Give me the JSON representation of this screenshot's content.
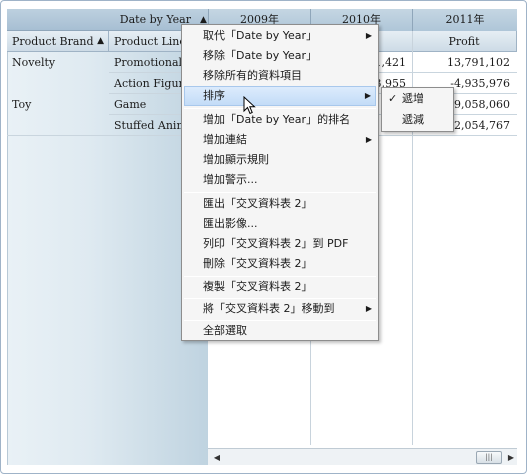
{
  "pivot": {
    "column_field": "Date by Year",
    "years": [
      "2009年",
      "2010年",
      "2011年"
    ],
    "row_headers": [
      "Product Brand",
      "Product Line"
    ],
    "measure": "Profit",
    "rows": [
      {
        "brand": "Novelty",
        "line": "Promotional",
        "v2010": "1,421",
        "v2011": "13,791,102"
      },
      {
        "brand": "",
        "line": "Action Figure",
        "v2010": "3,955",
        "v2011": "-4,935,976"
      },
      {
        "brand": "Toy",
        "line": "Game",
        "v2010": "",
        "v2011": "49,058,060"
      },
      {
        "brand": "",
        "line": "Stuffed Animal",
        "v2010": "",
        "v2011": "2,054,767"
      }
    ]
  },
  "context_menu": {
    "items": [
      {
        "label": "取代「Date by Year」",
        "submenu": true
      },
      {
        "label": "移除「Date by Year」",
        "submenu": false
      },
      {
        "label": "移除所有的資料項目",
        "submenu": false
      },
      {
        "label": "排序",
        "submenu": true
      },
      {
        "label": "增加「Date by Year」的排名",
        "submenu": false
      },
      {
        "label": "增加連結",
        "submenu": true
      },
      {
        "label": "增加顯示規則",
        "submenu": false
      },
      {
        "label": "增加警示...",
        "submenu": false
      },
      {
        "label": "匯出「交叉資料表 2」",
        "submenu": false
      },
      {
        "label": "匯出影像...",
        "submenu": false
      },
      {
        "label": "列印「交叉資料表 2」到 PDF",
        "submenu": false
      },
      {
        "label": "刪除「交叉資料表 2」",
        "submenu": false
      },
      {
        "label": "複製「交叉資料表 2」",
        "submenu": false
      },
      {
        "label": "將「交叉資料表 2」移動到",
        "submenu": true
      },
      {
        "label": "全部選取",
        "submenu": false
      }
    ]
  },
  "sort_submenu": {
    "items": [
      {
        "label": "遞增",
        "checked": true
      },
      {
        "label": "遞減",
        "checked": false
      }
    ]
  }
}
